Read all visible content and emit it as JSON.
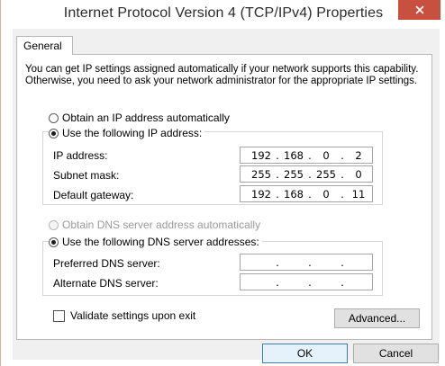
{
  "window": {
    "title": "Internet Protocol Version 4 (TCP/IPv4) Properties",
    "close_icon": "close-icon"
  },
  "tabs": [
    {
      "label": "General",
      "selected": true
    }
  ],
  "description": "You can get IP settings assigned automatically if your network supports this capability. Otherwise, you need to ask your network administrator for the appropriate IP settings.",
  "ip_mode": {
    "auto_label": "Obtain an IP address automatically",
    "manual_label": "Use the following IP address:",
    "selected": "manual"
  },
  "ip_fields": {
    "ip_address": {
      "label": "IP address:",
      "octets": [
        "192",
        "168",
        "0",
        "2"
      ]
    },
    "subnet_mask": {
      "label": "Subnet mask:",
      "octets": [
        "255",
        "255",
        "255",
        "0"
      ]
    },
    "default_gateway": {
      "label": "Default gateway:",
      "octets": [
        "192",
        "168",
        "0",
        "11"
      ]
    }
  },
  "dns_mode": {
    "auto_label": "Obtain DNS server address automatically",
    "auto_disabled": true,
    "manual_label": "Use the following DNS server addresses:",
    "selected": "manual"
  },
  "dns_fields": {
    "preferred": {
      "label": "Preferred DNS server:",
      "octets": [
        "",
        "",
        "",
        ""
      ]
    },
    "alternate": {
      "label": "Alternate DNS server:",
      "octets": [
        "",
        "",
        "",
        ""
      ]
    }
  },
  "validate": {
    "label": "Validate settings upon exit",
    "checked": false
  },
  "buttons": {
    "advanced": "Advanced...",
    "ok": "OK",
    "cancel": "Cancel"
  },
  "colors": {
    "close_button": "#c7503e",
    "dialog_background": "#f0f0f0",
    "default_button_border": "#3c7fb1"
  }
}
